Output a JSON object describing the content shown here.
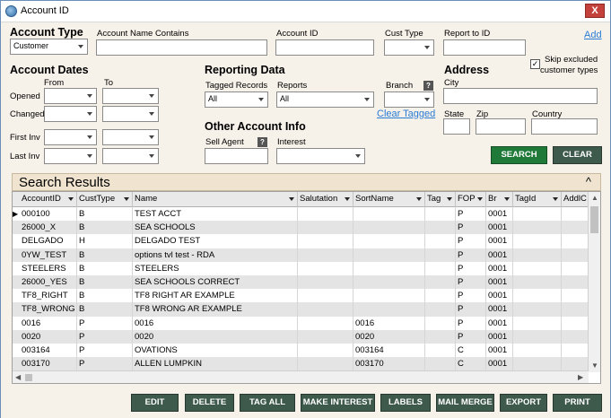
{
  "window": {
    "title": "Account ID",
    "close_label": "X"
  },
  "account_type": {
    "title": "Account Type",
    "value": "Customer"
  },
  "account_name": {
    "label": "Account Name Contains",
    "value": ""
  },
  "account_id": {
    "label": "Account ID",
    "value": ""
  },
  "cust_type": {
    "label": "Cust  Type",
    "value": ""
  },
  "report_to": {
    "label": "Report to ID",
    "value": ""
  },
  "add_link": "Add",
  "skip_excluded": {
    "label_line1": "Skip excluded",
    "label_line2": "customer types",
    "checked": "✓"
  },
  "account_dates": {
    "title": "Account Dates",
    "from_label": "From",
    "to_label": "To",
    "rows": [
      {
        "label": "Opened"
      },
      {
        "label": "Changed"
      },
      {
        "label": "First Inv"
      },
      {
        "label": "Last Inv"
      }
    ]
  },
  "reporting": {
    "title": "Reporting Data",
    "tagged_label": "Tagged Records",
    "tagged_value": "All",
    "reports_label": "Reports",
    "reports_value": "All",
    "branch_label": "Branch",
    "branch_help": "?",
    "clear_tagged": "Clear Tagged"
  },
  "other_info": {
    "title": "Other Account Info",
    "sell_agent_label": "Sell Agent",
    "sell_agent_help": "?",
    "interest_label": "Interest"
  },
  "address": {
    "title": "Address",
    "city_label": "City",
    "state_label": "State",
    "zip_label": "Zip",
    "country_label": "Country"
  },
  "buttons": {
    "search": "SEARCH",
    "clear": "CLEAR",
    "edit": "EDIT",
    "delete": "DELETE",
    "tag_all": "TAG ALL",
    "make_interest": "MAKE INTEREST",
    "labels": "LABELS",
    "mail_merge": "MAIL MERGE",
    "export": "EXPORT",
    "print": "PRINT"
  },
  "results": {
    "title": "Search Results",
    "collapse": "^",
    "columns": [
      "AccountID",
      "CustType",
      "Name",
      "Salutation",
      "SortName",
      "Tag",
      "FOP",
      "Br",
      "TagId",
      "AddlC"
    ],
    "rows": [
      [
        "000100",
        "B",
        "TEST ACCT",
        "",
        "",
        "",
        "P",
        "0001",
        "",
        ""
      ],
      [
        "26000_X",
        "B",
        "SEA SCHOOLS",
        "",
        "",
        "",
        "P",
        "0001",
        "",
        ""
      ],
      [
        "DELGADO",
        "H",
        "DELGADO TEST",
        "",
        "",
        "",
        "P",
        "0001",
        "",
        ""
      ],
      [
        "0YW_TEST",
        "B",
        "options tvl test - RDA",
        "",
        "",
        "",
        "P",
        "0001",
        "",
        ""
      ],
      [
        "STEELERS",
        "B",
        "STEELERS",
        "",
        "",
        "",
        "P",
        "0001",
        "",
        ""
      ],
      [
        "26000_YES",
        "B",
        "SEA SCHOOLS CORRECT",
        "",
        "",
        "",
        "P",
        "0001",
        "",
        ""
      ],
      [
        "TF8_RIGHT",
        "B",
        "TF8 RIGHT AR EXAMPLE",
        "",
        "",
        "",
        "P",
        "0001",
        "",
        ""
      ],
      [
        "TF8_WRONG",
        "B",
        "TF8 WRONG AR EXAMPLE",
        "",
        "",
        "",
        "P",
        "0001",
        "",
        ""
      ],
      [
        "0016",
        "P",
        "0016",
        "",
        "0016",
        "",
        "P",
        "0001",
        "",
        ""
      ],
      [
        "0020",
        "P",
        "0020",
        "",
        "0020",
        "",
        "P",
        "0001",
        "",
        ""
      ],
      [
        "003164",
        "P",
        "OVATIONS",
        "",
        "003164",
        "",
        "C",
        "0001",
        "",
        ""
      ],
      [
        "003170",
        "P",
        "ALLEN LUMPKIN",
        "",
        "003170",
        "",
        "C",
        "0001",
        "",
        ""
      ]
    ]
  }
}
